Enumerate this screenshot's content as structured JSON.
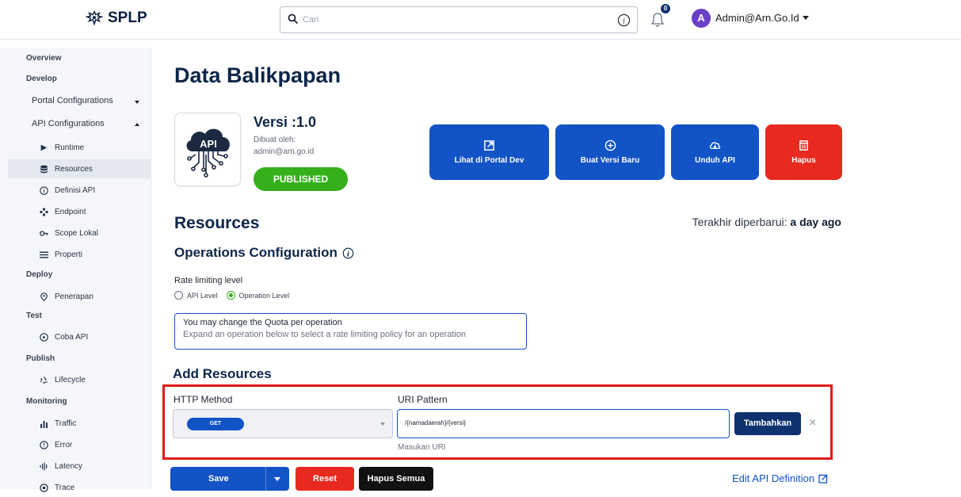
{
  "header": {
    "logo_text": "SPLP",
    "search_placeholder": "Cari",
    "notification_count": "0",
    "avatar_initial": "A",
    "user_name": "Admin@Arn.Go.Id"
  },
  "sidebar": {
    "overview": "Overview",
    "develop": "Develop",
    "portal_configurations": "Portal Configurations",
    "api_configurations": "API Configurations",
    "runtime": "Runtime",
    "resources": "Resources",
    "definisi_api": "Definisi API",
    "endpoint": "Endpoint",
    "scope_lokal": "Scope Lokal",
    "properti": "Properti",
    "deploy": "Deploy",
    "penerapan": "Penerapan",
    "test": "Test",
    "coba_api": "Coba API",
    "publish": "Publish",
    "lifecycle": "Lifecycle",
    "monitoring": "Monitoring",
    "traffic": "Traffic",
    "error": "Error",
    "latency": "Latency",
    "trace": "Trace"
  },
  "api": {
    "title": "Data Balikpapan",
    "version": "Versi :1.0",
    "created_by_label": "Dibuat oleh:",
    "created_by": "admin@arn.go.id",
    "status": "PUBLISHED"
  },
  "actions": {
    "view_portal": "Lihat di Portal Dev",
    "new_version": "Buat Versi Baru",
    "download": "Unduh API",
    "delete": "Hapus"
  },
  "resources": {
    "title": "Resources",
    "updated_label": "Terakhir diperbarui:",
    "updated_value": "a day ago",
    "ops_title": "Operations Configuration",
    "rate_label": "Rate limiting level",
    "radio_api": "API Level",
    "radio_operation": "Operation Level",
    "rate_selected": "Operation Level",
    "quota_line1": "You may change the Quota per operation",
    "quota_line2": "Expand an operation below to select a rate limiting policy for an operation"
  },
  "add_resources": {
    "title": "Add Resources",
    "http_label": "HTTP Method",
    "http_value": "GET",
    "uri_label": "URI Pattern",
    "uri_value": "/{namadaerah}/{versi}",
    "uri_hint": "Masukan URI",
    "add_button": "Tambahkan",
    "clear_icon": "×"
  },
  "footer": {
    "save": "Save",
    "reset": "Reset",
    "delete_all": "Hapus Semua",
    "edit_definition": "Edit API Definition"
  },
  "colors": {
    "primary": "#1254c6",
    "danger": "#e8291f",
    "success": "#35b01a",
    "dark_navy": "#0e3270",
    "highlight": "#e01b1b"
  },
  "icons": {
    "logo": "garuda-icon",
    "search": "search-icon",
    "info": "info-icon",
    "bell": "bell-icon",
    "external": "external-link-icon",
    "plus_circle": "plus-circle-icon",
    "cloud_download": "cloud-download-icon",
    "trash": "trash-icon"
  }
}
